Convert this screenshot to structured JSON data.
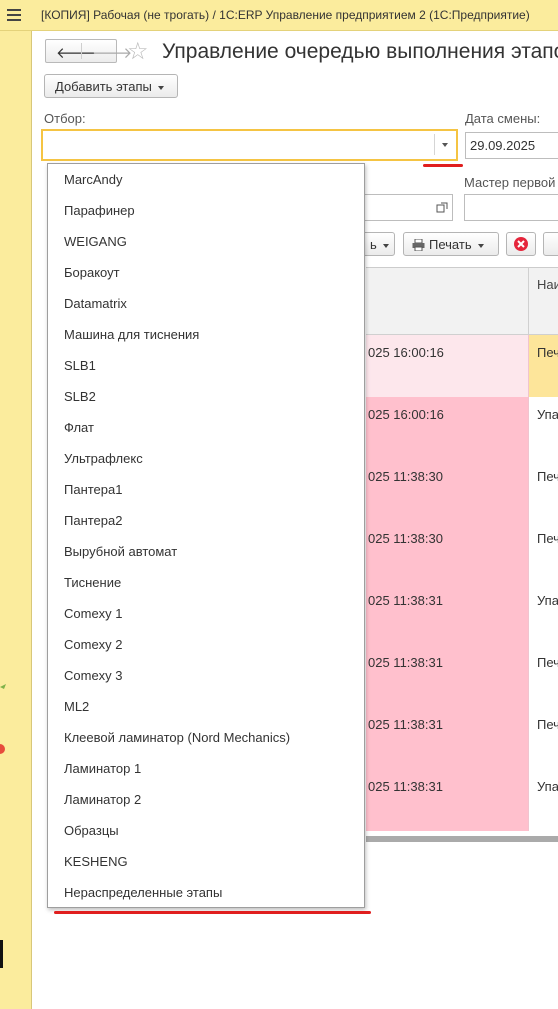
{
  "app": {
    "title": "[КОПИЯ] Рабочая (не трогать) / 1С:ERP Управление предприятием 2  (1С:Предприятие)"
  },
  "form": {
    "title": "Управление очередью выполнения этапов",
    "nav_back": "🡐",
    "nav_forward": "🡒",
    "favorite": "☆",
    "add_stages_label": "Добавить этапы",
    "filter_label": "Отбор:",
    "filter_value": "",
    "shift_date_label": "Дата смены:",
    "shift_date_value": "29.09.2025",
    "master_label": "Мастер первой",
    "master_value": "",
    "second_field_value": "",
    "print_label": "Печать",
    "more_label": "ь"
  },
  "table": {
    "header_col2": "Наи",
    "rows": [
      {
        "time": "025 16:00:16",
        "name": "Печ",
        "style": "highlight"
      },
      {
        "time": "025 16:00:16",
        "name": "Упа",
        "style": "pink"
      },
      {
        "time": "025 11:38:30",
        "name": "Печ",
        "style": "pink"
      },
      {
        "time": "025 11:38:30",
        "name": "Печ",
        "style": "pink"
      },
      {
        "time": "025 11:38:31",
        "name": "Упа",
        "style": "pink"
      },
      {
        "time": "025 11:38:31",
        "name": "Печ",
        "style": "pink"
      },
      {
        "time": "025 11:38:31",
        "name": "Печ",
        "style": "pink"
      },
      {
        "time": "025 11:38:31",
        "name": "Упа",
        "style": "pink"
      }
    ]
  },
  "filter_options": [
    "MarcAndy",
    "Парафинер",
    "WEIGANG",
    "Боракоут",
    "Datamatrix",
    "Машина для тиснения",
    "SLB1",
    "SLB2",
    "Флат",
    "Ультрафлекс",
    "Пантера1",
    "Пантера2",
    "Вырубной автомат",
    "Тиснение",
    "Comexy 1",
    "Comexy 2",
    "Comexy 3",
    "ML2",
    "Клеевой ламинатор (Nord Mechanics)",
    "Ламинатор 1",
    "Ламинатор 2",
    "Образцы",
    "KESHENG",
    "Нераспределенные этапы"
  ],
  "colors": {
    "titlebar": "#fbec9d",
    "row_pink": "#ffc0cd",
    "row_highlight_left": "#fde7ec",
    "row_highlight_right": "#fde59a",
    "focus_border": "#f5c443",
    "annotation_red": "#e01e1e"
  }
}
